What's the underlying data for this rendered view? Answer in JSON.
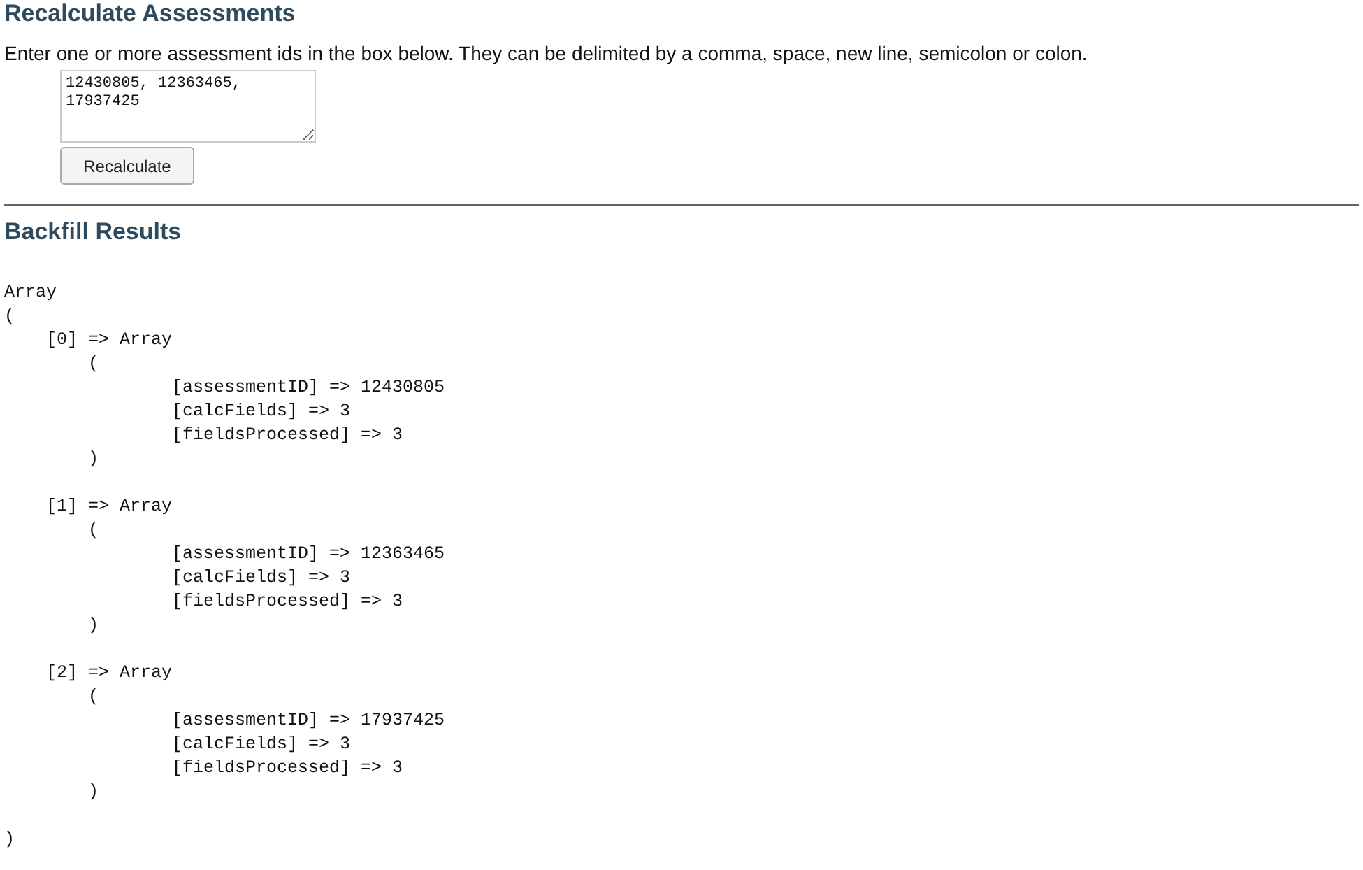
{
  "recalculate": {
    "title": "Recalculate Assessments",
    "instructions": "Enter one or more assessment ids in the box below. They can be delimited by a comma, space, new line, semicolon or colon.",
    "ids_value": "12430805, 12363465, 17937425",
    "button": "Recalculate"
  },
  "results": {
    "title": "Backfill Results",
    "output": {
      "label": "Array",
      "open": "(",
      "close": ")",
      "children": [
        {
          "label": "[0] => Array",
          "open": "(",
          "close": ")",
          "children": [
            {
              "label": "[assessmentID] => 12430805"
            },
            {
              "label": "[calcFields] => 3"
            },
            {
              "label": "[fieldsProcessed] => 3"
            }
          ]
        },
        {
          "label": "[1] => Array",
          "open": "(",
          "close": ")",
          "children": [
            {
              "label": "[assessmentID] => 12363465"
            },
            {
              "label": "[calcFields] => 3"
            },
            {
              "label": "[fieldsProcessed] => 3"
            }
          ]
        },
        {
          "label": "[2] => Array",
          "open": "(",
          "close": ")",
          "children": [
            {
              "label": "[assessmentID] => 17937425"
            },
            {
              "label": "[calcFields] => 3"
            },
            {
              "label": "[fieldsProcessed] => 3"
            }
          ]
        }
      ]
    }
  }
}
